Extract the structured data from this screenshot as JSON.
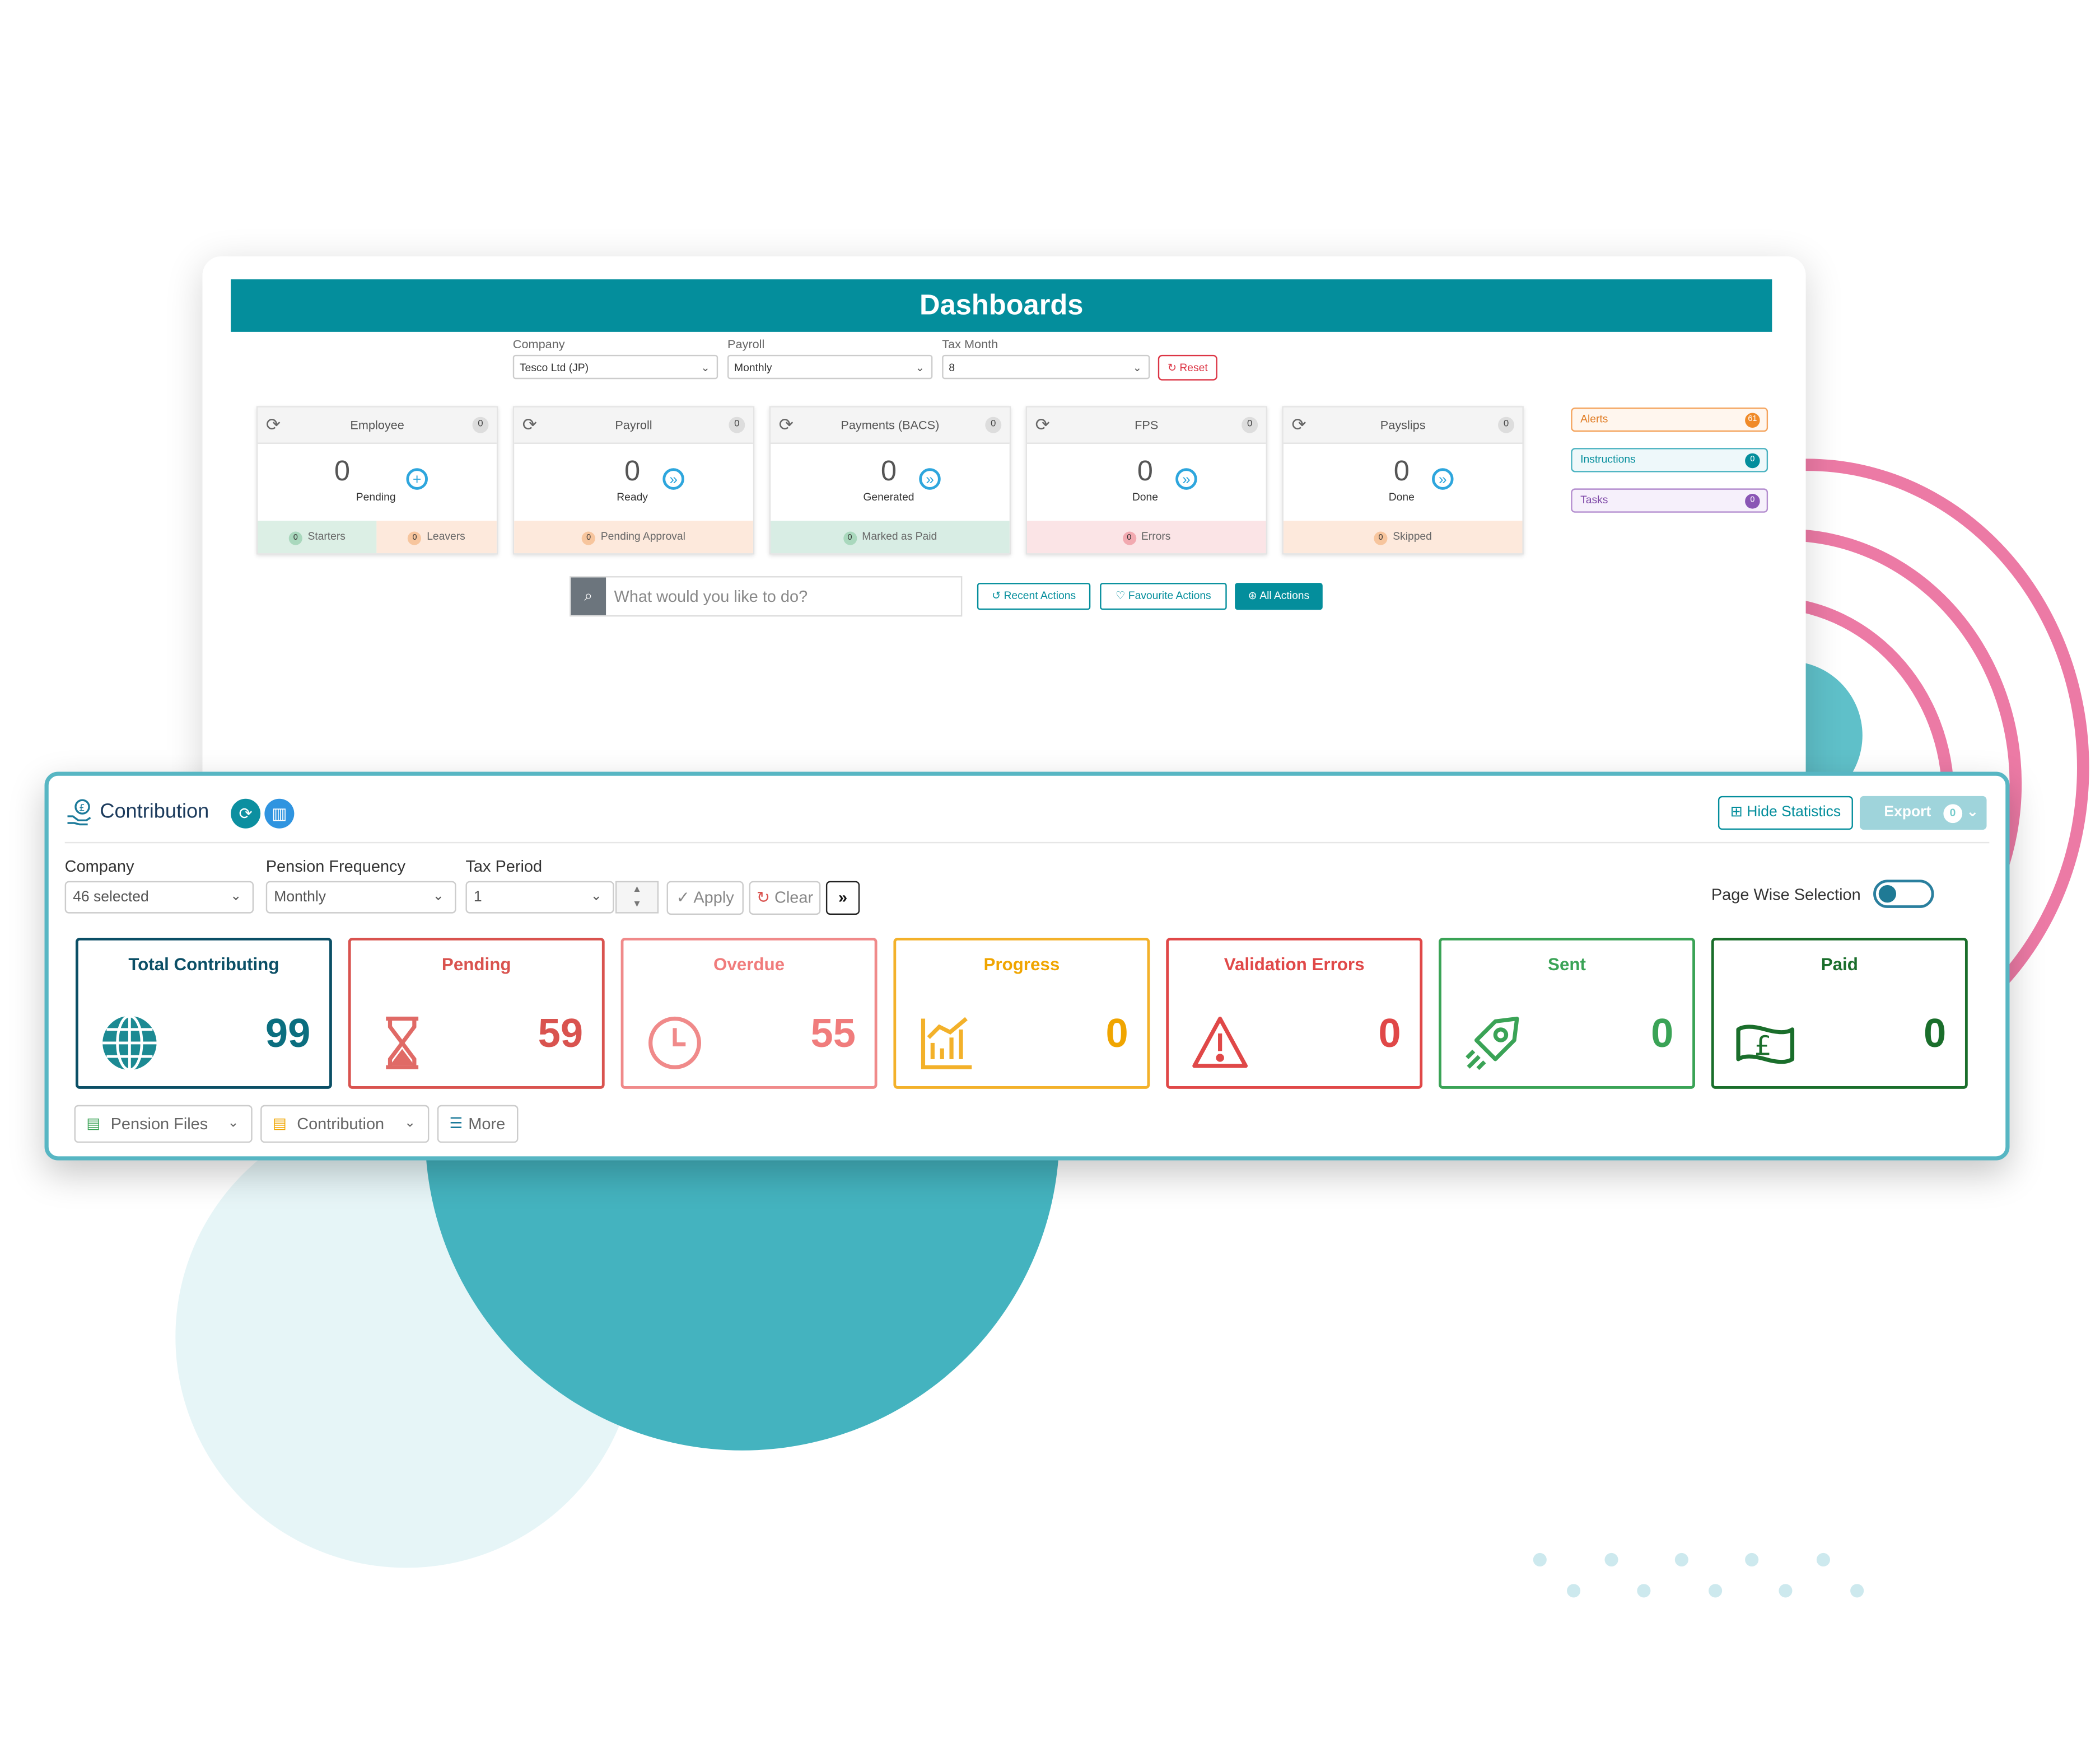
{
  "dashboard": {
    "title": "Dashboards",
    "filters": {
      "company_label": "Company",
      "company_value": "Tesco Ltd (JP)",
      "payroll_label": "Payroll",
      "payroll_value": "Monthly",
      "tax_month_label": "Tax Month",
      "tax_month_value": "8",
      "reset_label": "Reset"
    },
    "cards": [
      {
        "title": "Employee",
        "badge": "0",
        "value": "0",
        "subtitle": "Pending",
        "footer": [
          {
            "count": "0",
            "label": "Starters"
          },
          {
            "count": "0",
            "label": "Leavers"
          }
        ]
      },
      {
        "title": "Payroll",
        "badge": "0",
        "value": "0",
        "subtitle": "Ready",
        "footer": [
          {
            "count": "0",
            "label": "Pending Approval"
          }
        ]
      },
      {
        "title": "Payments (BACS)",
        "badge": "0",
        "value": "0",
        "subtitle": "Generated",
        "footer": [
          {
            "count": "0",
            "label": "Marked as Paid"
          }
        ]
      },
      {
        "title": "FPS",
        "badge": "0",
        "value": "0",
        "subtitle": "Done",
        "footer": [
          {
            "count": "0",
            "label": "Errors"
          }
        ]
      },
      {
        "title": "Payslips",
        "badge": "0",
        "value": "0",
        "subtitle": "Done",
        "footer": [
          {
            "count": "0",
            "label": "Skipped"
          }
        ]
      }
    ],
    "side_items": [
      {
        "label": "Alerts",
        "count": "61"
      },
      {
        "label": "Instructions",
        "count": "0"
      },
      {
        "label": "Tasks",
        "count": "0"
      }
    ],
    "search_placeholder": "What would you like to do?",
    "actions": {
      "recent": "Recent Actions",
      "favourite": "Favourite Actions",
      "all": "All Actions"
    }
  },
  "contribution": {
    "title": "Contribution",
    "hide_statistics_label": "Hide Statistics",
    "export_label": "Export",
    "export_count": "0",
    "filters": {
      "company_label": "Company",
      "company_value": "46 selected",
      "pension_frequency_label": "Pension Frequency",
      "pension_frequency_value": "Monthly",
      "tax_period_label": "Tax Period",
      "tax_period_value": "1",
      "apply_label": "Apply",
      "clear_label": "Clear"
    },
    "page_wise_selection_label": "Page Wise Selection",
    "page_wise_selection_on": false,
    "stats": [
      {
        "title": "Total Contributing",
        "value": "99",
        "color": "#0b6e7f",
        "icon": "globe-icon"
      },
      {
        "title": "Pending",
        "value": "59",
        "color": "#d9534f",
        "icon": "hourglass-icon"
      },
      {
        "title": "Overdue",
        "value": "55",
        "color": "#f07c7c",
        "icon": "clock-icon"
      },
      {
        "title": "Progress",
        "value": "0",
        "color": "#f0a500",
        "icon": "chart-icon"
      },
      {
        "title": "Validation Errors",
        "value": "0",
        "color": "#e04848",
        "icon": "warning-icon"
      },
      {
        "title": "Sent",
        "value": "0",
        "color": "#3aa356",
        "icon": "rocket-icon"
      },
      {
        "title": "Paid",
        "value": "0",
        "color": "#1a6e2b",
        "icon": "pound-note-icon"
      }
    ],
    "bottom_buttons": {
      "pension_files": "Pension Files",
      "contribution": "Contribution",
      "more": "More"
    }
  }
}
